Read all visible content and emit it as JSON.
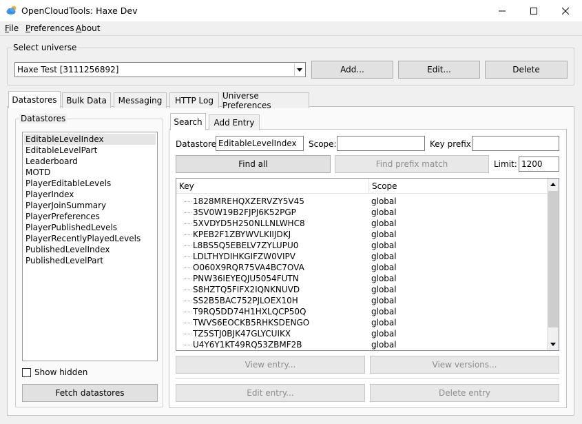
{
  "window": {
    "title": "OpenCloudTools: Haxe Dev"
  },
  "menu": {
    "file": "File",
    "preferences": "Preferences",
    "about": "About"
  },
  "universe": {
    "group_label": "Select universe",
    "selected": "Haxe Test [3111256892]",
    "add_label": "Add...",
    "edit_label": "Edit...",
    "delete_label": "Delete"
  },
  "main_tabs": [
    "Datastores",
    "Bulk Data",
    "Messaging",
    "HTTP Log",
    "Universe Preferences"
  ],
  "datastores": {
    "group_label": "Datastores",
    "items": [
      "EditableLevelIndex",
      "EditableLevelPart",
      "Leaderboard",
      "MOTD",
      "PlayerEditableLevels",
      "PlayerIndex",
      "PlayerJoinSummary",
      "PlayerPreferences",
      "PlayerPublishedLevels",
      "PlayerRecentlyPlayedLevels",
      "PublishedLevelIndex",
      "PublishedLevelPart"
    ],
    "selected_index": 0,
    "show_hidden_label": "Show hidden",
    "show_hidden_checked": false,
    "fetch_label": "Fetch datastores"
  },
  "sub_tabs": [
    "Search",
    "Add Entry"
  ],
  "search": {
    "datastore_label": "Datastore:",
    "datastore_value": "EditableLevelIndex",
    "scope_label": "Scope:",
    "scope_value": "",
    "key_prefix_label": "Key prefix:",
    "key_prefix_value": "",
    "find_all_label": "Find all",
    "find_prefix_label": "Find prefix match",
    "limit_label": "Limit:",
    "limit_value": "1200"
  },
  "results": {
    "columns": [
      "Key",
      "Scope"
    ],
    "rows": [
      {
        "key": "1828MREHQXZERVZY5V45",
        "scope": "global"
      },
      {
        "key": "3SV0W19B2FJPJ6K52PGP",
        "scope": "global"
      },
      {
        "key": "5XVDYD5H250NLLNLWHC8",
        "scope": "global"
      },
      {
        "key": "KPEB2F1ZBYWVLKIIJDKJ",
        "scope": "global"
      },
      {
        "key": "L8BS5Q5EBELV7ZYLUPU0",
        "scope": "global"
      },
      {
        "key": "LDLTHYDIHKGIFZW0VIPV",
        "scope": "global"
      },
      {
        "key": "O060X9RQR75VA4BC7OVA",
        "scope": "global"
      },
      {
        "key": "PNW36IEYEQJU5054FUTN",
        "scope": "global"
      },
      {
        "key": "S8HZTQ5FIFX2IQNKNUVD",
        "scope": "global"
      },
      {
        "key": "SS2B5BAC752PJLOEX10H",
        "scope": "global"
      },
      {
        "key": "T9RQ5DD74H1HXLQCP50Q",
        "scope": "global"
      },
      {
        "key": "TWVS6EOCKB5RHKSDENGO",
        "scope": "global"
      },
      {
        "key": "TZ5STJ0BJK47GLYCUIKX",
        "scope": "global"
      },
      {
        "key": "U4Y6Y1KT49RQ53ZBMF2B",
        "scope": "global"
      }
    ]
  },
  "entry_actions": {
    "view_entry": "View entry...",
    "view_versions": "View versions...",
    "edit_entry": "Edit entry...",
    "delete_entry": "Delete entry"
  },
  "icons": {
    "app": "cloud-icon",
    "minimize": "minimize-icon",
    "maximize": "maximize-icon",
    "close": "close-icon"
  },
  "colors": {
    "app_icon_blue": "#3d8fe0",
    "app_icon_yellow": "#f2b632"
  }
}
